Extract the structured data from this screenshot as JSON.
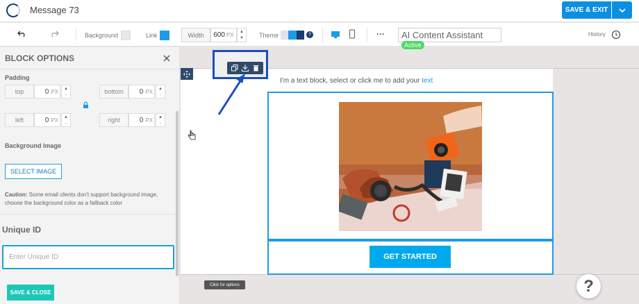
{
  "header": {
    "title": "Message 73",
    "save_exit": "SAVE & EXIT"
  },
  "toolbar": {
    "background_label": "Background",
    "background_color": "#e8e4e4",
    "link_label": "Link",
    "link_color": "#1e9be6",
    "width_label": "Width",
    "width_value": "600",
    "width_unit": "PX",
    "theme_label": "Theme",
    "ai_text": "AI Content Assistant",
    "ai_badge": "Active",
    "history_label": "History"
  },
  "sidebar": {
    "title": "BLOCK OPTIONS",
    "padding_label": "Padding",
    "padding": {
      "top": {
        "label": "top",
        "value": "0",
        "unit": "PX"
      },
      "bottom": {
        "label": "bottom",
        "value": "0",
        "unit": "PX"
      },
      "left": {
        "label": "left",
        "value": "0",
        "unit": "PX"
      },
      "right": {
        "label": "right",
        "value": "0",
        "unit": "PX"
      }
    },
    "bg_image_label": "Background Image",
    "select_image": "SELECT IMAGE",
    "caution_bold": "Caution:",
    "caution_text": " Some email clients don't support background image, choose the background color as a fallback color",
    "unique_id_label": "Unique ID",
    "unique_id_placeholder": "Enter Unique ID",
    "save_close": "SAVE & CLOSE"
  },
  "canvas": {
    "text_block": "I'm a text block, select or click me to add your ",
    "text_link": "text",
    "button_label": "GET STARTED",
    "tooltip": "Click for options"
  },
  "help": "?"
}
